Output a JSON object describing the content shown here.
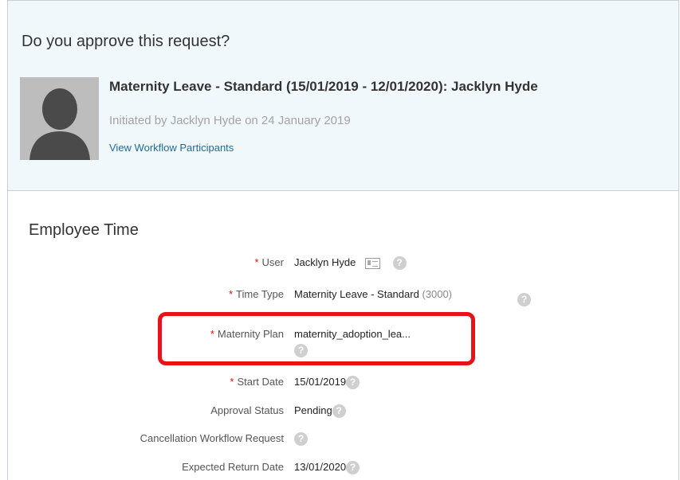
{
  "approval": {
    "question": "Do you approve this request?",
    "request_title": "Maternity Leave - Standard (15/01/2019 - 12/01/2020): Jacklyn Hyde",
    "initiated_text": "Initiated by Jacklyn Hyde on 24 January 2019",
    "workflow_link": "View Workflow Participants"
  },
  "employee_time": {
    "title": "Employee Time",
    "required_marker": "*",
    "help_glyph": "?",
    "fields": {
      "user": {
        "label": "User",
        "value": "Jacklyn Hyde",
        "icon": "contact-card-icon"
      },
      "time_type": {
        "label": "Time Type",
        "value": "Maternity Leave - Standard",
        "code": "(3000)"
      },
      "maternity_plan": {
        "label": "Maternity Plan",
        "value": "maternity_adoption_lea..."
      },
      "start_date": {
        "label": "Start Date",
        "value": "15/01/2019"
      },
      "approval_status": {
        "label": "Approval Status",
        "value": "Pending"
      },
      "cancellation": {
        "label": "Cancellation Workflow Request"
      },
      "expected_return": {
        "label": "Expected Return Date",
        "value": "13/01/2020"
      }
    }
  },
  "colors": {
    "accent_link": "#1e6aa0",
    "required": "#d9120d",
    "highlight_box": "#e8131a",
    "panel_bg": "#f1f8fc"
  }
}
